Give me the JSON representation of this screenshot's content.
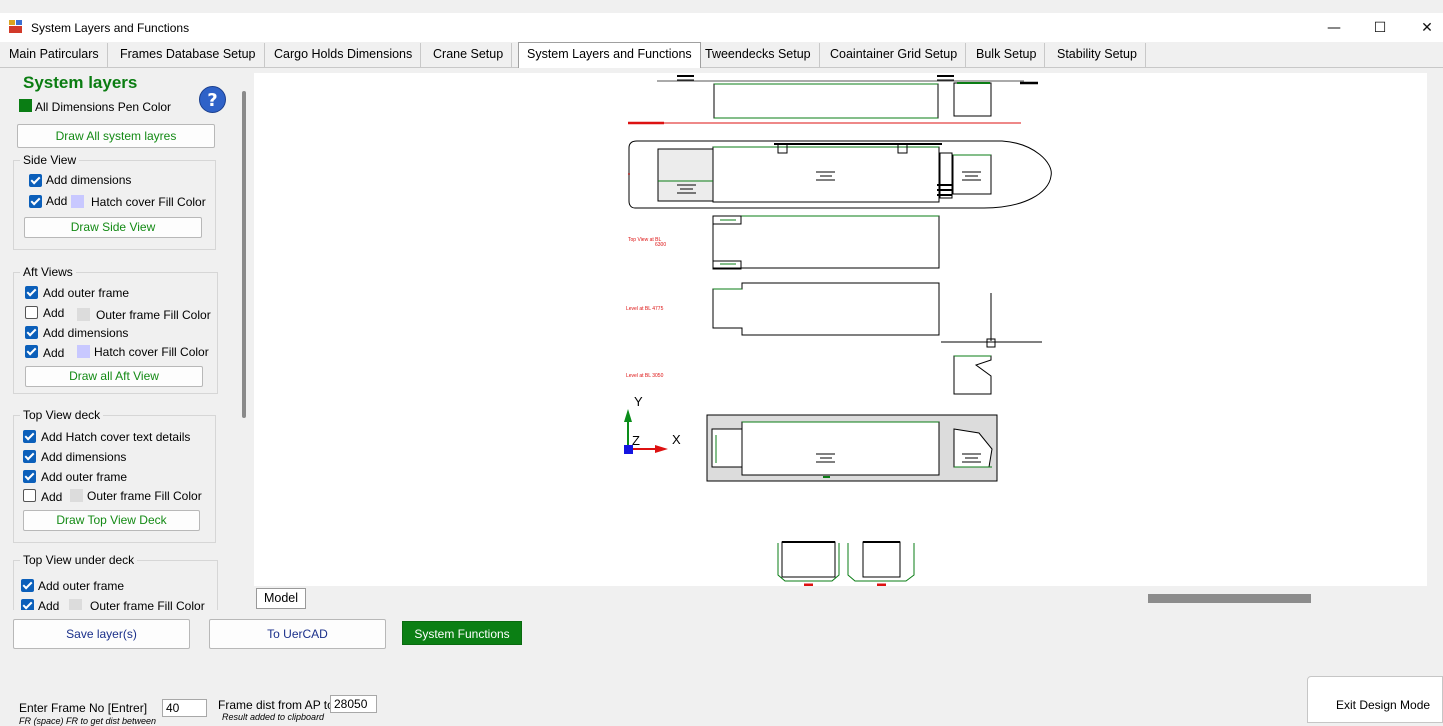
{
  "window": {
    "title": "System Layers and Functions",
    "controls": {
      "minimize": "—",
      "maximize": "☐",
      "close": "✕"
    }
  },
  "tabs": [
    {
      "label": "Main Patirculars"
    },
    {
      "label": "Frames Database Setup"
    },
    {
      "label": "Cargo Holds Dimensions"
    },
    {
      "label": "Crane Setup"
    },
    {
      "label": "System Layers and Functions",
      "active": true
    },
    {
      "label": "Tweendecks Setup"
    },
    {
      "label": "Coaintainer Grid Setup"
    },
    {
      "label": "Bulk Setup"
    },
    {
      "label": "Stability Setup"
    }
  ],
  "left": {
    "title": "System layers",
    "pen_color_label": "All Dimensions Pen Color",
    "help": "?",
    "draw_all_button": "Draw All system layres",
    "side_view": {
      "title": "Side View",
      "add_dimensions": "Add dimensions",
      "add": "Add",
      "hatch_fill": "Hatch cover Fill Color",
      "draw_button": "Draw Side View"
    },
    "aft_views": {
      "title": "Aft Views",
      "add_outer_frame": "Add outer frame",
      "add": "Add",
      "outer_fill": "Outer frame Fill Color",
      "add_dimensions": "Add dimensions",
      "hatch_fill": "Hatch cover Fill Color",
      "draw_button": "Draw all Aft View"
    },
    "top_view_deck": {
      "title": "Top View deck",
      "add_hatch_text": "Add Hatch cover text details",
      "add_dimensions": "Add dimensions",
      "add_outer_frame": "Add outer frame",
      "add": "Add",
      "outer_fill": "Outer frame Fill Color",
      "draw_button": "Draw Top View Deck"
    },
    "top_view_under": {
      "title": "Top View under deck",
      "add_outer_frame": "Add outer frame",
      "add": "Add",
      "outer_fill": "Outer frame Fill Color"
    }
  },
  "canvas": {
    "model_tab": "Model",
    "axis_x": "X",
    "axis_y": "Y",
    "axis_z": "Z",
    "tiny_label_1": "Top View at BL",
    "tiny_label_1b": "6300",
    "tiny_label_2": "Level at BL 4775",
    "tiny_label_3": "Level at BL 3050"
  },
  "bottom": {
    "save_button": "Save layer(s)",
    "to_uercad_button": "To UerCAD",
    "system_functions_button": "System Functions",
    "frame_label": "Enter Frame No [Entrer]",
    "frame_value": "40",
    "frame_hint": "FR (space) FR to get dist between",
    "dist_label": "Frame dist from AP to Fr",
    "dist_value": "28050",
    "result_note": "Result  added to clipboard",
    "exit_button": "Exit Design Mode"
  },
  "colors": {
    "accent_green": "#0b7f14",
    "pen_green": "#0a7d14",
    "hatch_fill": "#c8c8ff",
    "outer_fill": "#dcdcdc",
    "drawing_red": "#d11"
  }
}
